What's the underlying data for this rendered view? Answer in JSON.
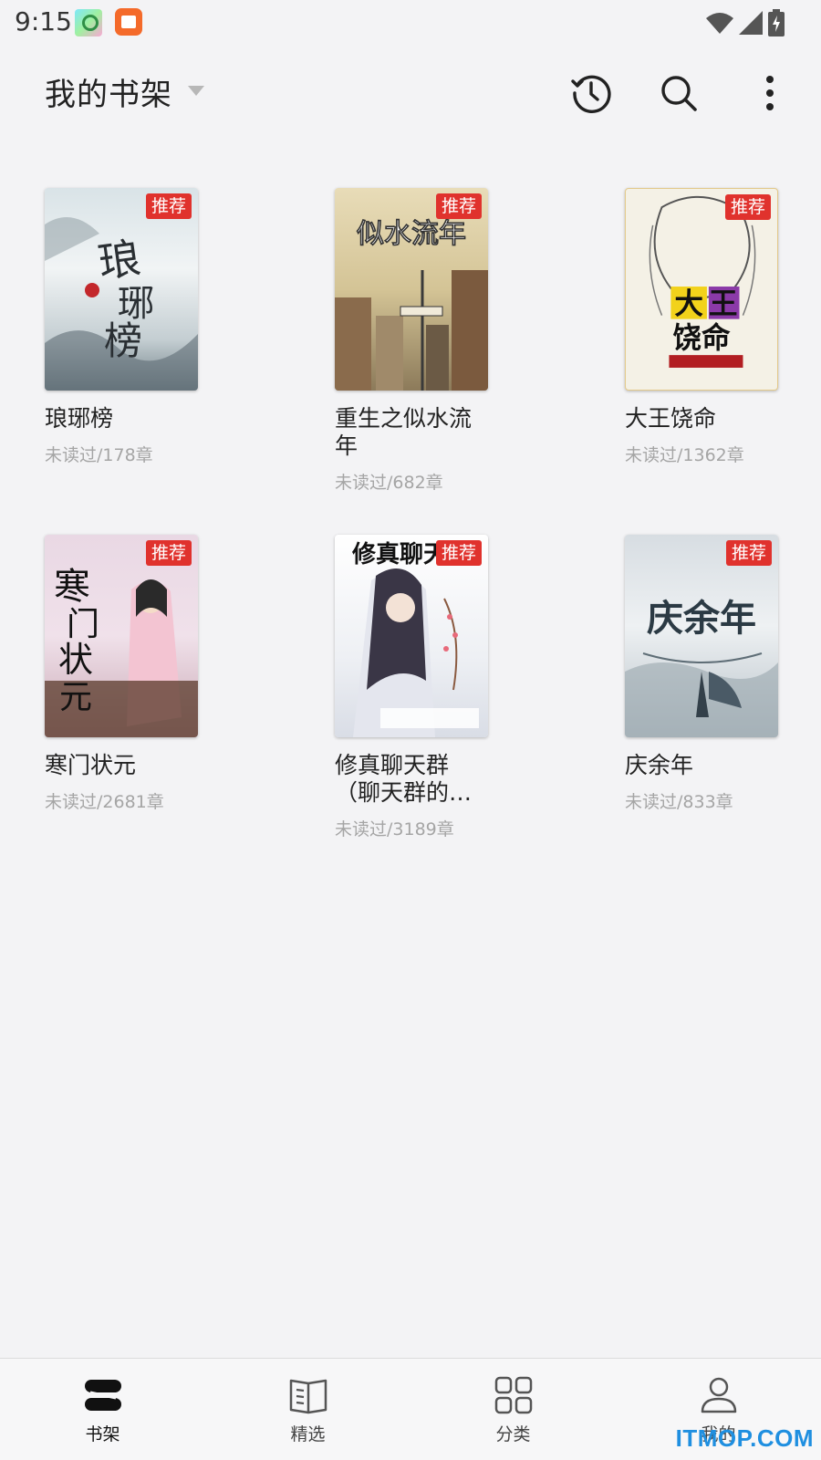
{
  "status_bar": {
    "time": "9:15",
    "icons": [
      "app-icon-avatar",
      "app-icon-book",
      "wifi-icon",
      "signal-icon",
      "battery-charging-icon"
    ]
  },
  "header": {
    "title": "我的书架",
    "actions": [
      "history-icon",
      "search-icon",
      "more-vertical-icon"
    ]
  },
  "books": [
    {
      "title": "琅琊榜",
      "meta": "未读过/178章",
      "tag": "推荐",
      "cover_text": "琅琊榜"
    },
    {
      "title": "重生之似水流年",
      "meta": "未读过/682章",
      "tag": "推荐",
      "cover_text": "似水流年"
    },
    {
      "title": "大王饶命",
      "meta": "未读过/1362章",
      "tag": "推荐",
      "cover_text": "大王饶命"
    },
    {
      "title": "寒门状元",
      "meta": "未读过/2681章",
      "tag": "推荐",
      "cover_text": "寒门状元"
    },
    {
      "title": "修真聊天群（聊天群的…",
      "meta": "未读过/3189章",
      "tag": "推荐",
      "cover_text": "修真聊天群"
    },
    {
      "title": "庆余年",
      "meta": "未读过/833章",
      "tag": "推荐",
      "cover_text": "庆余年"
    }
  ],
  "bottom_nav": {
    "items": [
      {
        "label": "书架",
        "icon": "bookshelf-icon",
        "active": true
      },
      {
        "label": "精选",
        "icon": "open-book-icon",
        "active": false
      },
      {
        "label": "分类",
        "icon": "grid-icon",
        "active": false
      },
      {
        "label": "我的",
        "icon": "person-icon",
        "active": false
      }
    ]
  },
  "watermark": "ITMOP.COM",
  "colors": {
    "tag": "#e0322d",
    "background": "#f3f3f5",
    "watermark": "#1f8fe0"
  }
}
